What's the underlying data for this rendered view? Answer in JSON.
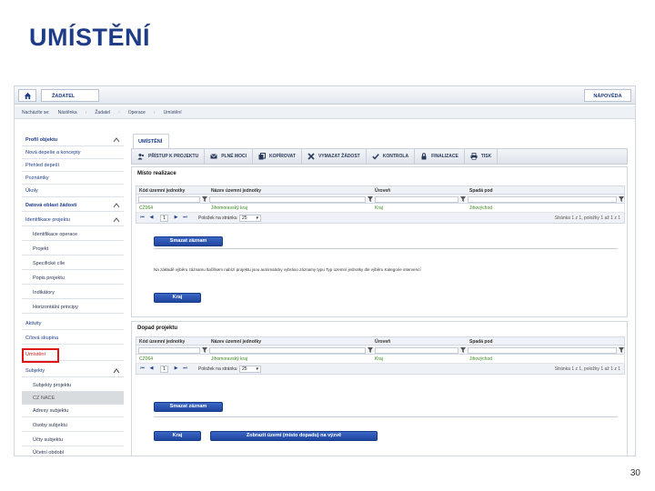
{
  "slide": {
    "title": "UMÍSTĚNÍ",
    "page_number": "30"
  },
  "topbar": {
    "applicant": "ŽADATEL",
    "help": "NÁPOVĚDA"
  },
  "breadcrumb": [
    "Nacházíte se:",
    "Nástěnka",
    "Žadatel",
    "Operace",
    "Umístění"
  ],
  "sidebar": {
    "items": [
      {
        "label": "Profil objektu"
      },
      {
        "label": "Nová depeše a koncepty"
      },
      {
        "label": "Přehled depeší"
      },
      {
        "label": "Poznámky"
      },
      {
        "label": "Úkoly"
      },
      {
        "label": "Datová oblast žádosti"
      },
      {
        "label": "Identifikace projektu"
      },
      {
        "label": "Identifikace operace"
      },
      {
        "label": "Projekt"
      },
      {
        "label": "Specifické cíle"
      },
      {
        "label": "Popis projektu"
      },
      {
        "label": "Indikátory"
      },
      {
        "label": "Horizontální principy"
      },
      {
        "label": "Aktivity"
      },
      {
        "label": "Cílová skupina"
      },
      {
        "label": "Umístění"
      },
      {
        "label": "Subjekty"
      },
      {
        "label": "Subjekty projektu"
      },
      {
        "label": "CZ NACE"
      },
      {
        "label": "Adresy subjektu"
      },
      {
        "label": "Osoby subjektu"
      },
      {
        "label": "Účty subjektu"
      },
      {
        "label": "Účetní období"
      }
    ]
  },
  "main": {
    "tab": "UMÍSTĚNÍ",
    "toolbar": [
      "PŘÍSTUP K PROJEKTU",
      "PLNÉ MOCI",
      "KOPÍROVAT",
      "VYMAZAT ŽÁDOST",
      "KONTROLA",
      "FINALIZACE",
      "TISK"
    ],
    "columns": [
      "Kód územní jednotky",
      "Název územní jednotky",
      "Úroveň",
      "Spadá pod"
    ],
    "location": {
      "title": "Místo realizace",
      "row": [
        "CZ064",
        "Jihomoravský kraj",
        "Kraj",
        "Jihovýchod"
      ],
      "delete_btn": "Smazat záznam",
      "note": "Na základě výběru záznamu tlačítkem nabízí projektu jsou automaticky vybráno záznamy typu Typ územní jednotky dle výběru Kategorie intervencí",
      "region_btn": "Kraj"
    },
    "impact": {
      "title": "Dopad projektu",
      "row": [
        "CZ064",
        "Jihomoravský kraj",
        "Kraj",
        "Jihovýchod"
      ],
      "delete_btn": "Smazat záznam",
      "region_btn": "Kraj",
      "show_btn": "Zobrazit území (místo dopadu) na výzvě"
    },
    "pager": {
      "page": "1",
      "per_page_label": "Položek na stránku",
      "per_page": "25",
      "info": "Stránka 1 z 1, položky 1 až 1 z 1"
    }
  },
  "colors": {
    "accent": "#1f3c88",
    "button": "#2a55b5",
    "highlight": "#e01616",
    "link_green": "#3a8a1e"
  }
}
